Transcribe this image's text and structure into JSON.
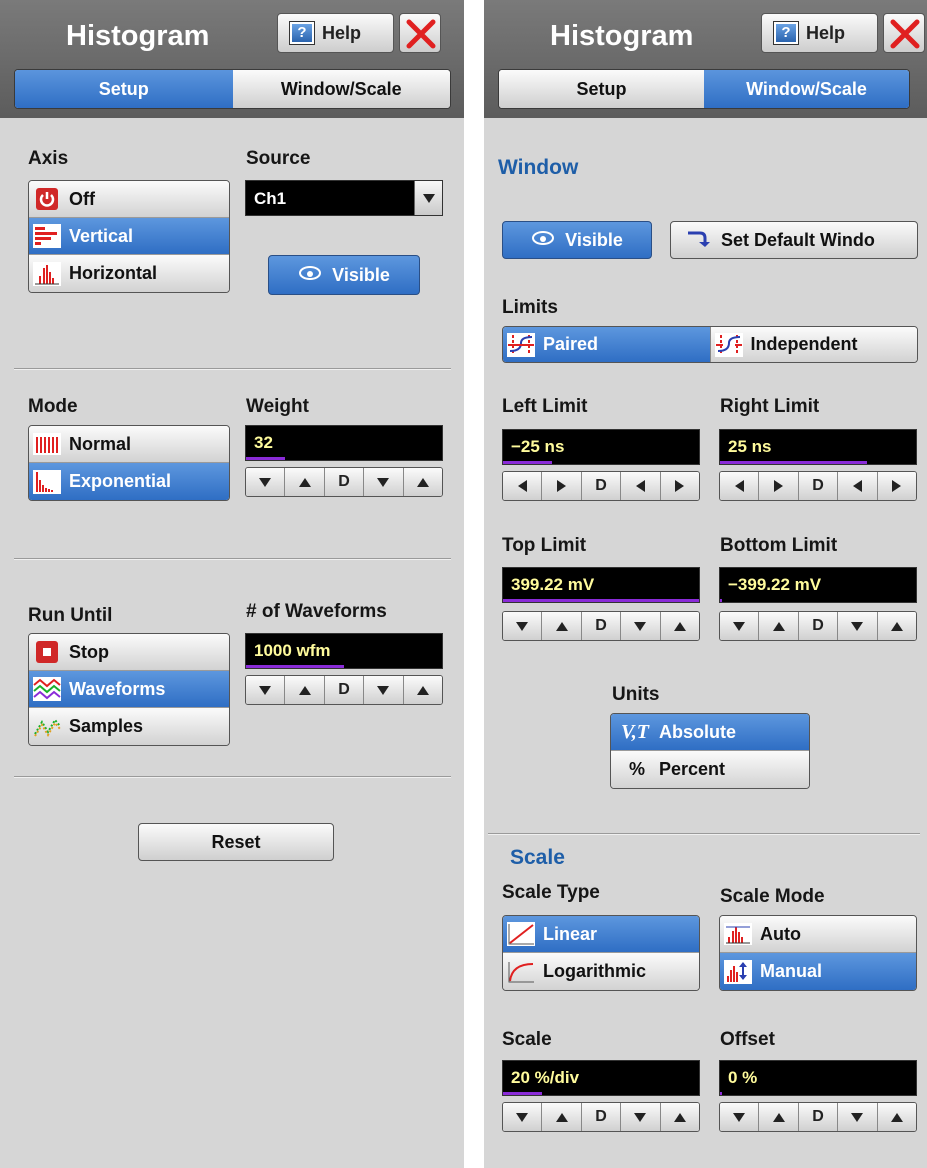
{
  "left": {
    "title": "Histogram",
    "help_label": "Help",
    "tabs": [
      "Setup",
      "Window/Scale"
    ],
    "active_tab": "Setup",
    "axis": {
      "label": "Axis",
      "options": [
        "Off",
        "Vertical",
        "Horizontal"
      ],
      "selected": "Vertical"
    },
    "source": {
      "label": "Source",
      "value": "Ch1"
    },
    "visible_label": "Visible",
    "mode": {
      "label": "Mode",
      "options": [
        "Normal",
        "Exponential"
      ],
      "selected": "Exponential"
    },
    "weight": {
      "label": "Weight",
      "value": "32",
      "level": 0.2
    },
    "run_until": {
      "label": "Run Until",
      "options": [
        "Stop",
        "Waveforms",
        "Samples"
      ],
      "selected": "Waveforms"
    },
    "num_waveforms": {
      "label": "# of Waveforms",
      "value": "1000 wfm",
      "level": 0.5
    },
    "reset_label": "Reset",
    "stepper_d": "D"
  },
  "right": {
    "title": "Histogram",
    "help_label": "Help",
    "tabs": [
      "Setup",
      "Window/Scale"
    ],
    "active_tab": "Window/Scale",
    "window_heading": "Window",
    "visible_label": "Visible",
    "set_default_label": "Set Default Windo",
    "limits": {
      "label": "Limits",
      "options": [
        "Paired",
        "Independent"
      ],
      "selected": "Paired"
    },
    "left_limit": {
      "label": "Left Limit",
      "value": "−25 ns",
      "level": 0.25
    },
    "right_limit": {
      "label": "Right Limit",
      "value": "25 ns",
      "level": 0.75
    },
    "top_limit": {
      "label": "Top Limit",
      "value": "399.22 mV",
      "level": 1.0
    },
    "bottom_limit": {
      "label": "Bottom Limit",
      "value": "−399.22 mV",
      "level": 0.01
    },
    "units": {
      "label": "Units",
      "options": [
        "Absolute",
        "Percent"
      ],
      "selected": "Absolute",
      "icons": [
        "V,T",
        "%"
      ]
    },
    "scale_heading": "Scale",
    "scale_type": {
      "label": "Scale Type",
      "options": [
        "Linear",
        "Logarithmic"
      ],
      "selected": "Linear"
    },
    "scale_mode": {
      "label": "Scale Mode",
      "options": [
        "Auto",
        "Manual"
      ],
      "selected": "Manual"
    },
    "scale": {
      "label": "Scale",
      "value": "20 %/div",
      "level": 0.2
    },
    "offset": {
      "label": "Offset",
      "value": "0 %",
      "level": 0.01
    },
    "stepper_d": "D"
  },
  "colors": {
    "accent_blue": "#2f6ec4",
    "field_text": "#fffb9c",
    "level_bar": "#8a2bd8",
    "close_red": "#e02020"
  }
}
